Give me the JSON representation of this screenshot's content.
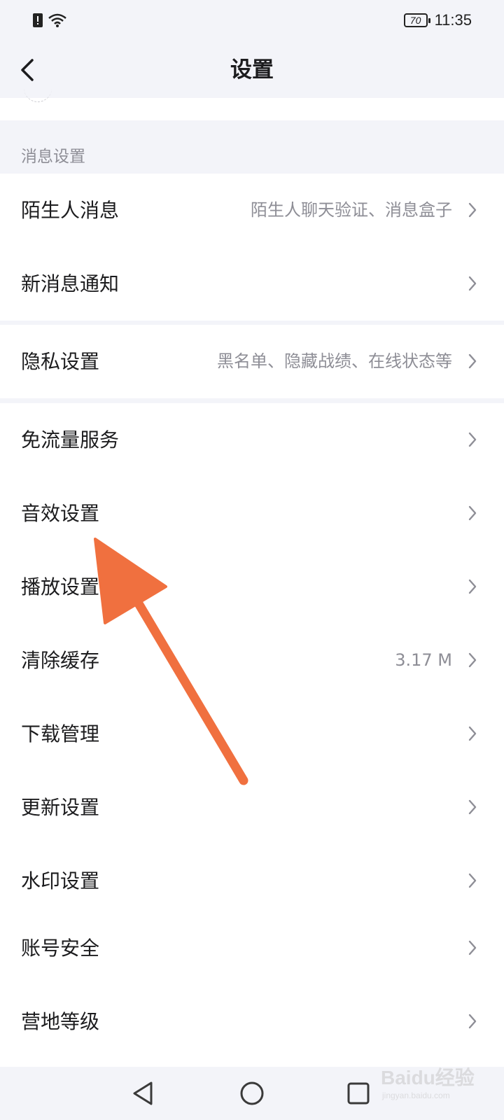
{
  "status_bar": {
    "battery": "70",
    "time": "11:35"
  },
  "header": {
    "title": "设置",
    "back_icon": "chevron-left-icon"
  },
  "section": {
    "label": "消息设置"
  },
  "groups": [
    {
      "items": [
        {
          "label": "陌生人消息",
          "value": "陌生人聊天验证、消息盒子"
        },
        {
          "label": "新消息通知",
          "value": ""
        }
      ]
    },
    {
      "items": [
        {
          "label": "隐私设置",
          "value": "黑名单、隐藏战绩、在线状态等"
        }
      ]
    },
    {
      "items": [
        {
          "label": "免流量服务",
          "value": ""
        },
        {
          "label": "音效设置",
          "value": ""
        },
        {
          "label": "播放设置",
          "value": ""
        },
        {
          "label": "清除缓存",
          "value": "3.17 M"
        },
        {
          "label": "下载管理",
          "value": ""
        },
        {
          "label": "更新设置",
          "value": ""
        },
        {
          "label": "水印设置",
          "value": ""
        }
      ]
    },
    {
      "items": [
        {
          "label": "账号安全",
          "value": ""
        },
        {
          "label": "营地等级",
          "value": ""
        }
      ]
    }
  ],
  "nav": {
    "back": "triangle-back-icon",
    "home": "circle-home-icon",
    "recents": "square-recents-icon"
  },
  "annotation": {
    "color": "#f0703f"
  },
  "watermark": {
    "main": "Baidu经验",
    "sub": "jingyan.baidu.com"
  }
}
